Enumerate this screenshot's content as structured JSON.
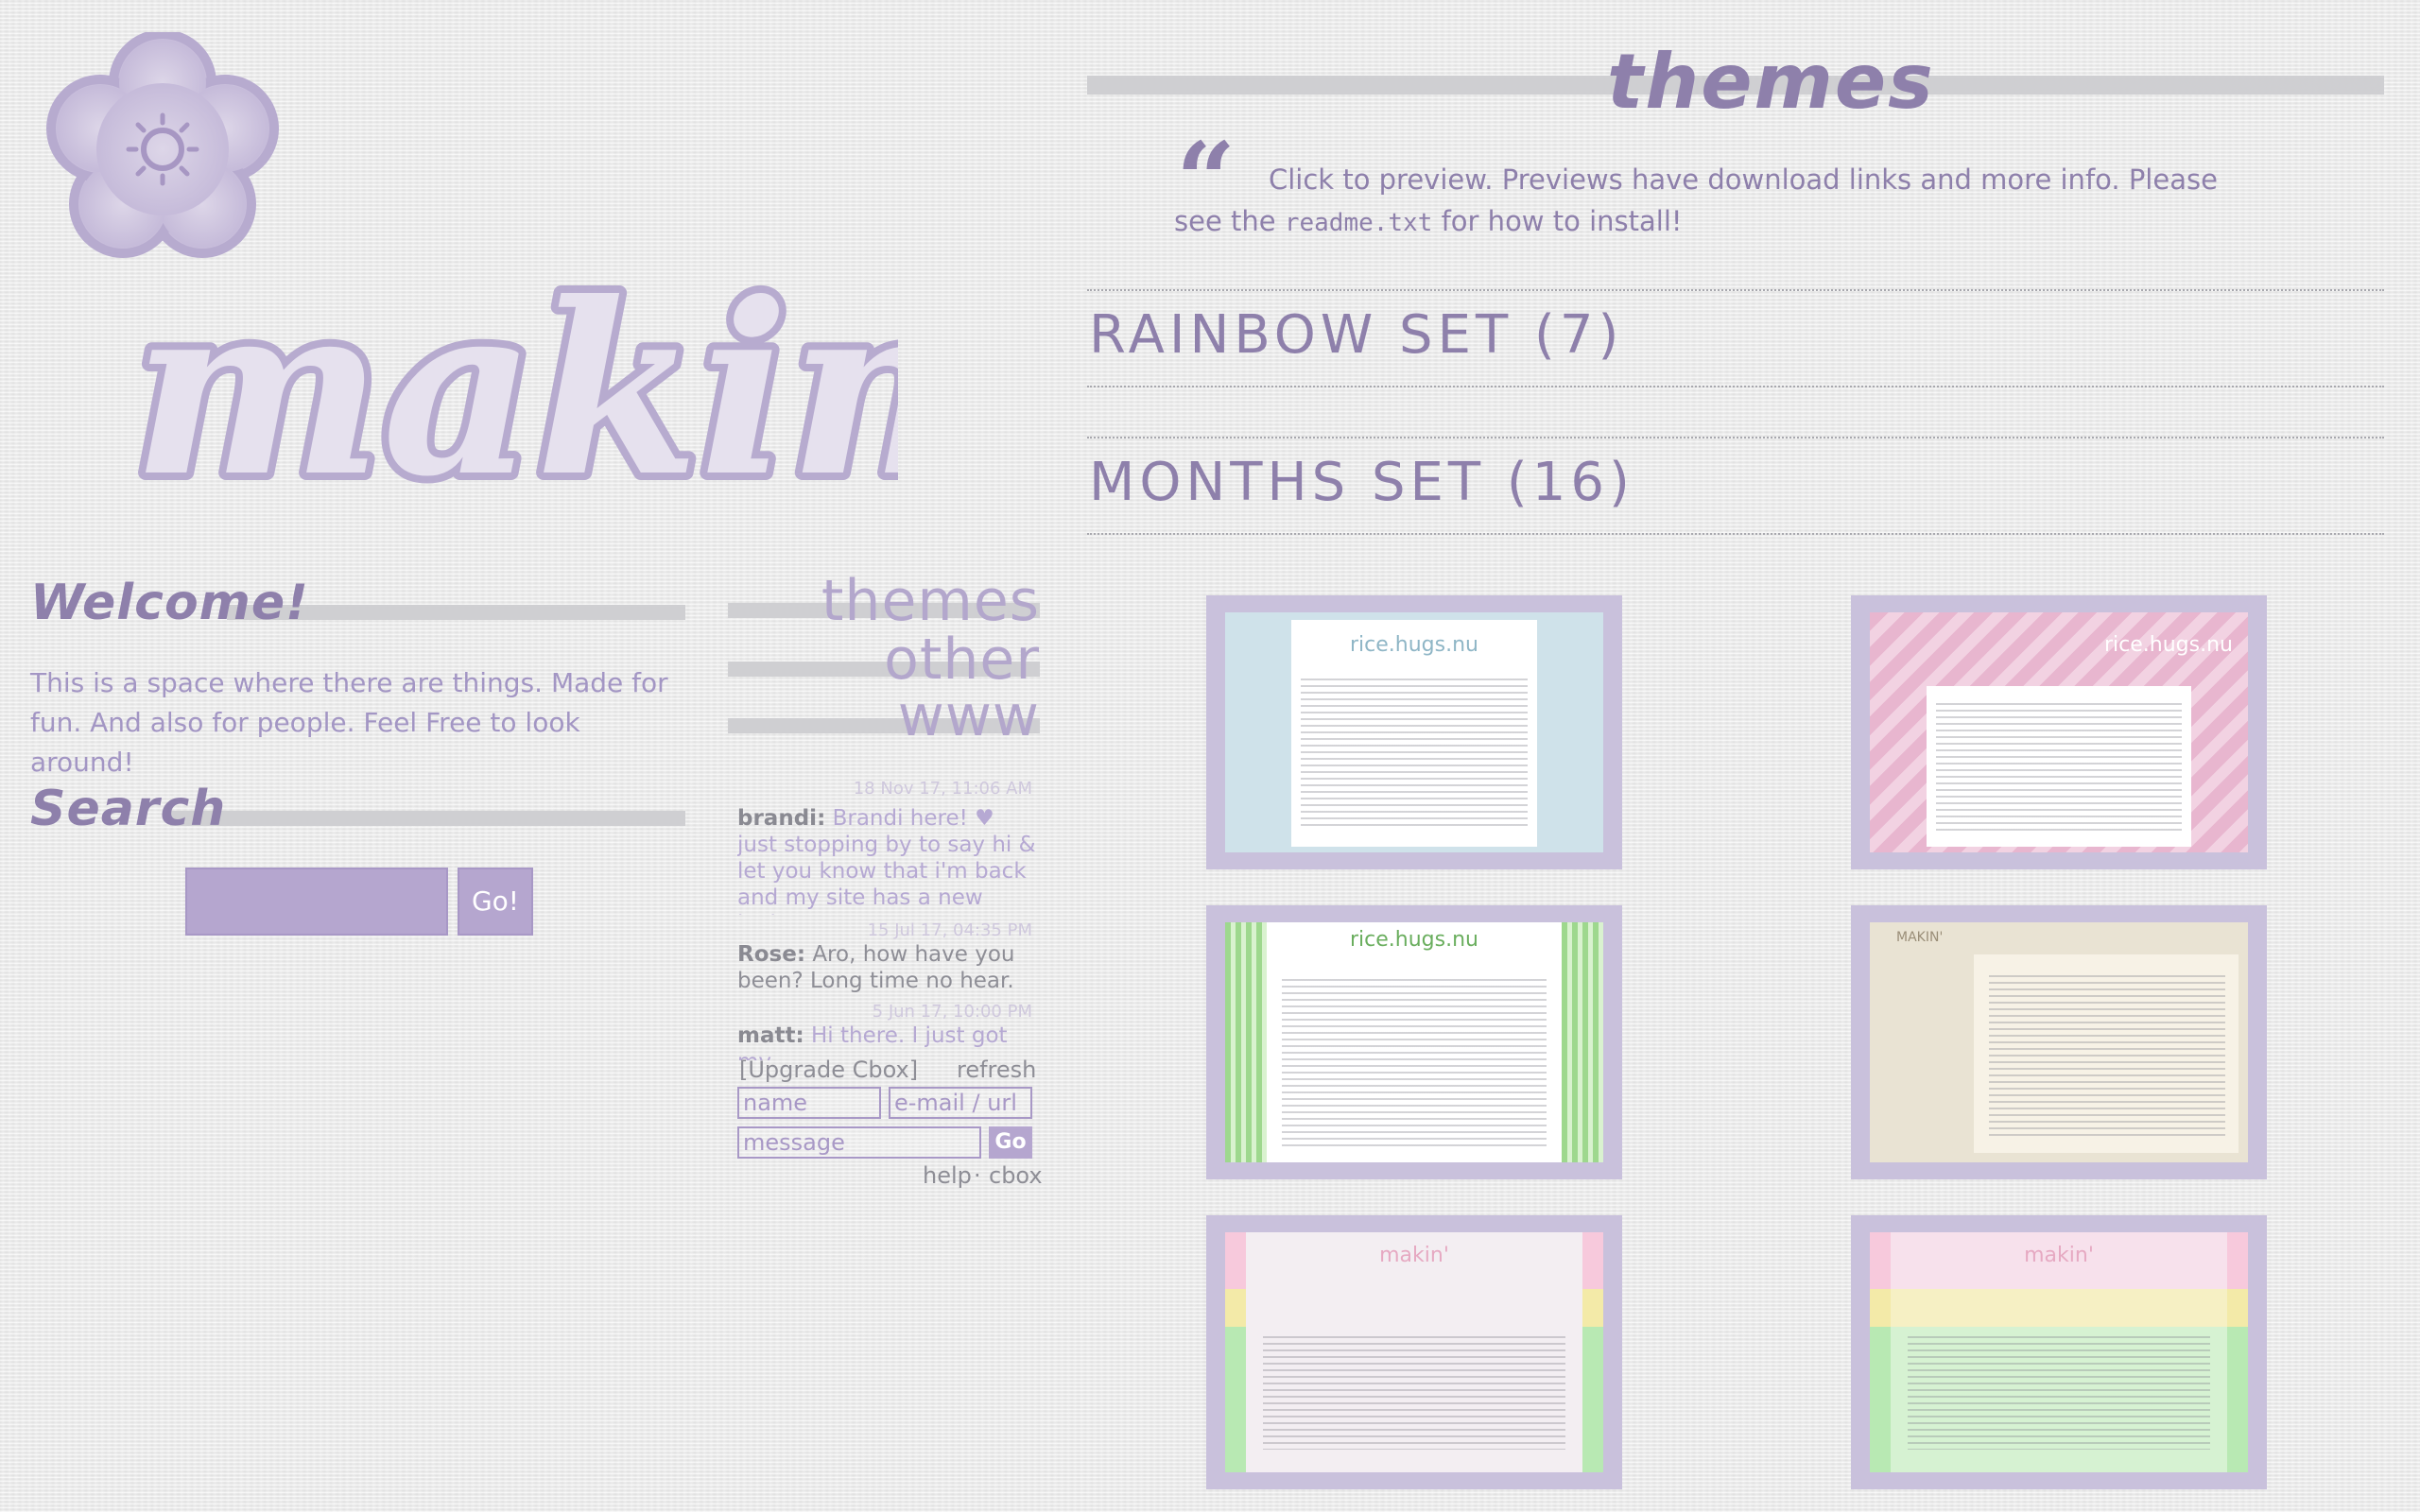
{
  "colors": {
    "accent": "#8e80ab",
    "light_accent": "#b5a6cf",
    "background": "#ececec"
  },
  "logo": {
    "wordmark": "makin'",
    "icon": "flower-icon"
  },
  "sidebar": {
    "welcome_heading": "Welcome!",
    "welcome_text": "This is a space where there are things. Made for fun. And also for people. Feel Free to look around!",
    "search_heading": "Search",
    "search_button": "Go!"
  },
  "nav": {
    "items": [
      "themes",
      "other",
      "www"
    ]
  },
  "cbox": {
    "messages": [
      {
        "time": "18 Nov 17, 11:06 AM",
        "name": "brandi",
        "text": "Brandi here! ♥ just stopping by to say hi & let you know that i'm back and my site has a new look, a"
      },
      {
        "time": "15 Jul 17, 04:35 PM",
        "name": "Rose",
        "text": "Aro, how have you been? Long time no hear."
      },
      {
        "time": "5 Jun 17, 10:00 PM",
        "name": "matt",
        "text": "Hi there. I just got my"
      }
    ],
    "upgrade": "[Upgrade Cbox]",
    "refresh": "refresh",
    "name_placeholder": "name",
    "email_placeholder": "e-mail / url",
    "message_placeholder": "message",
    "go": "Go",
    "help": "help",
    "separator": "·",
    "cbox_link": "cbox"
  },
  "main": {
    "title": "themes",
    "intro_before": "Click to preview. Previews have download links and more info. Please see the",
    "intro_code": "readme.txt",
    "intro_after": "for how to install!",
    "sets": [
      {
        "label": "RAINBOW SET (7)"
      },
      {
        "label": "MONTHS SET (16)"
      }
    ],
    "thumbnails": [
      {
        "label": "rice.hugs.nu",
        "bg": "#cfe2ea"
      },
      {
        "label": "rice.hugs.nu",
        "bg": "#e8b6cf"
      },
      {
        "label": "rice.hugs.nu",
        "bg": "#b6e3a6"
      },
      {
        "label": "MAKIN'",
        "bg": "#e9e3d3"
      },
      {
        "label": "makin'",
        "bg": "#f3eef2"
      },
      {
        "label": "makin'",
        "bg": "#f3eef2"
      }
    ]
  }
}
